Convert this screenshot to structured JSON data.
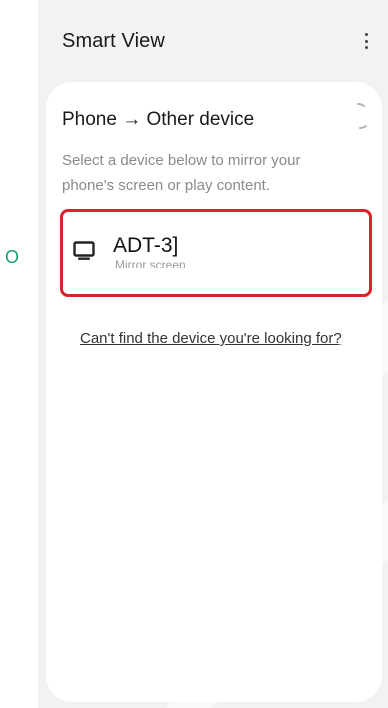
{
  "header": {
    "title": "Smart View",
    "menu_icon": "more-vertical-icon"
  },
  "panel": {
    "title": "Phone → Other device",
    "description": "Select a device below to mirror your phone's screen or play content.",
    "spinner_icon": "loading-spinner-icon"
  },
  "devices": [
    {
      "name": "ADT-3]",
      "subtitle": "Mirror screen",
      "icon": "tv-icon"
    }
  ],
  "help_link": "Can't find the device you're looking for?",
  "margin_mark": "O",
  "colors": {
    "highlight_border": "#d8232a",
    "margin_mark": "#19a06b",
    "background": "#f2f2f2",
    "card": "#ffffff"
  }
}
